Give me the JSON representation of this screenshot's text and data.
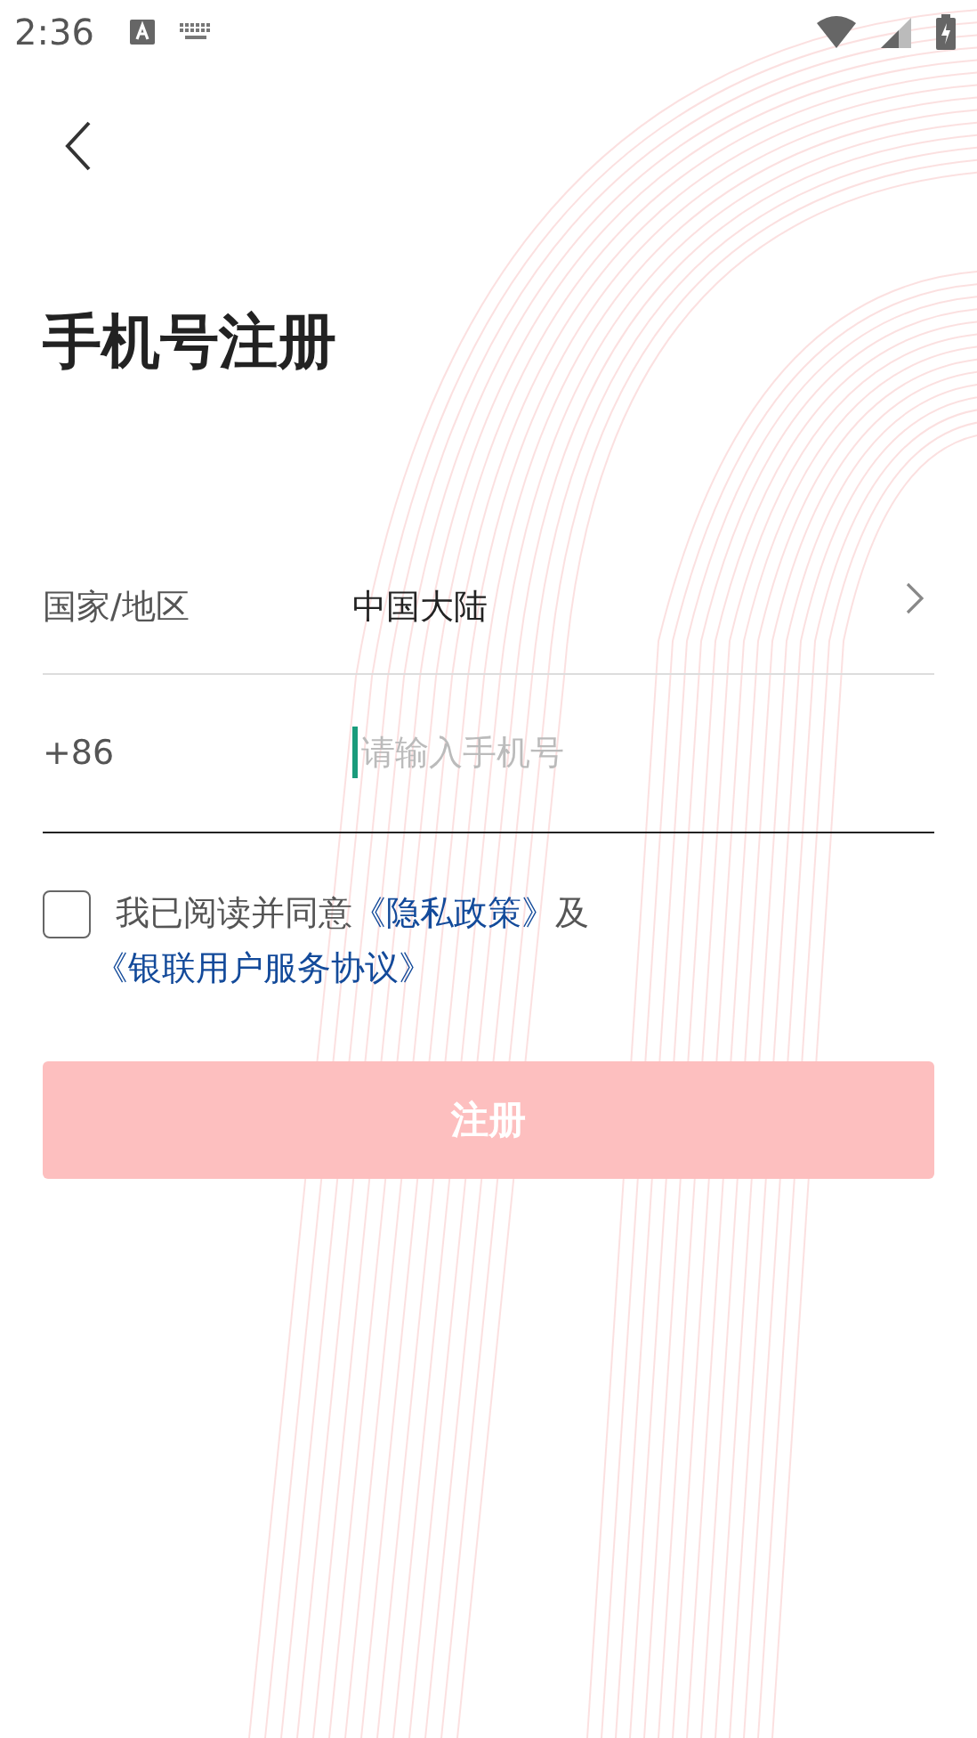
{
  "status_bar": {
    "time": "2:36"
  },
  "title": "手机号注册",
  "country": {
    "label": "国家/地区",
    "value": "中国大陆"
  },
  "phone": {
    "code": "+86",
    "placeholder": "请输入手机号",
    "focused": true
  },
  "agreement": {
    "checked": false,
    "text": "我已阅读并同意",
    "privacy_link": "《隐私政策》",
    "conjunction": "及",
    "service_link": "《银联用户服务协议》"
  },
  "register_button": {
    "label": "注册",
    "disabled": true
  }
}
